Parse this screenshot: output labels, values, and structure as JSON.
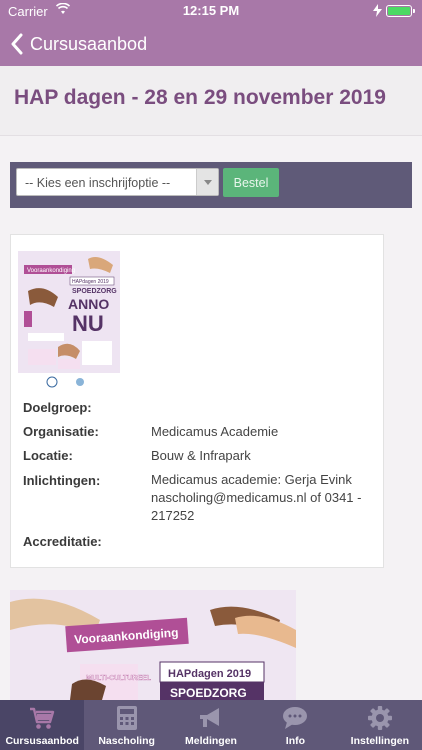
{
  "status_bar": {
    "carrier": "Carrier",
    "time": "12:15 PM",
    "battery_level": 1.0
  },
  "nav": {
    "back_label": "Cursusaanbod"
  },
  "page": {
    "title": "HAP dagen - 28 en 29 november 2019"
  },
  "order": {
    "select_value": "-- Kies een inschrijfoptie --",
    "order_button": "Bestel"
  },
  "details": {
    "rows": [
      {
        "label": "Doelgroep:",
        "value": ""
      },
      {
        "label": "Organisatie:",
        "value": "Medicamus Academie"
      },
      {
        "label": "Locatie:",
        "value": "Bouw & Infrapark"
      },
      {
        "label": "Inlichtingen:",
        "value": "Medicamus academie: Gerja Evink nascholing@medicamus.nl of 0341 - 217252"
      },
      {
        "label": "Accreditatie:",
        "value": ""
      }
    ]
  },
  "poster": {
    "badge": "Vooraankondiging",
    "banner": "HAPdagen 2019",
    "sub": "SPOEDZORG",
    "big1": "ANNO",
    "big2": "NU",
    "tag": "MULTI-CULTUREEL"
  },
  "tabs": [
    {
      "label": "Cursusaanbod",
      "icon": "cart-icon",
      "active": true
    },
    {
      "label": "Nascholing",
      "icon": "calculator-icon",
      "active": false
    },
    {
      "label": "Meldingen",
      "icon": "megaphone-icon",
      "active": false
    },
    {
      "label": "Info",
      "icon": "speech-bubble-icon",
      "active": false
    },
    {
      "label": "Instellingen",
      "icon": "gear-icon",
      "active": false
    }
  ],
  "colors": {
    "header": "#a878a8",
    "title": "#7a4d7f",
    "order_bar": "#5f5a78",
    "order_button": "#5bb57a",
    "tab_bar": "#5f5878"
  }
}
